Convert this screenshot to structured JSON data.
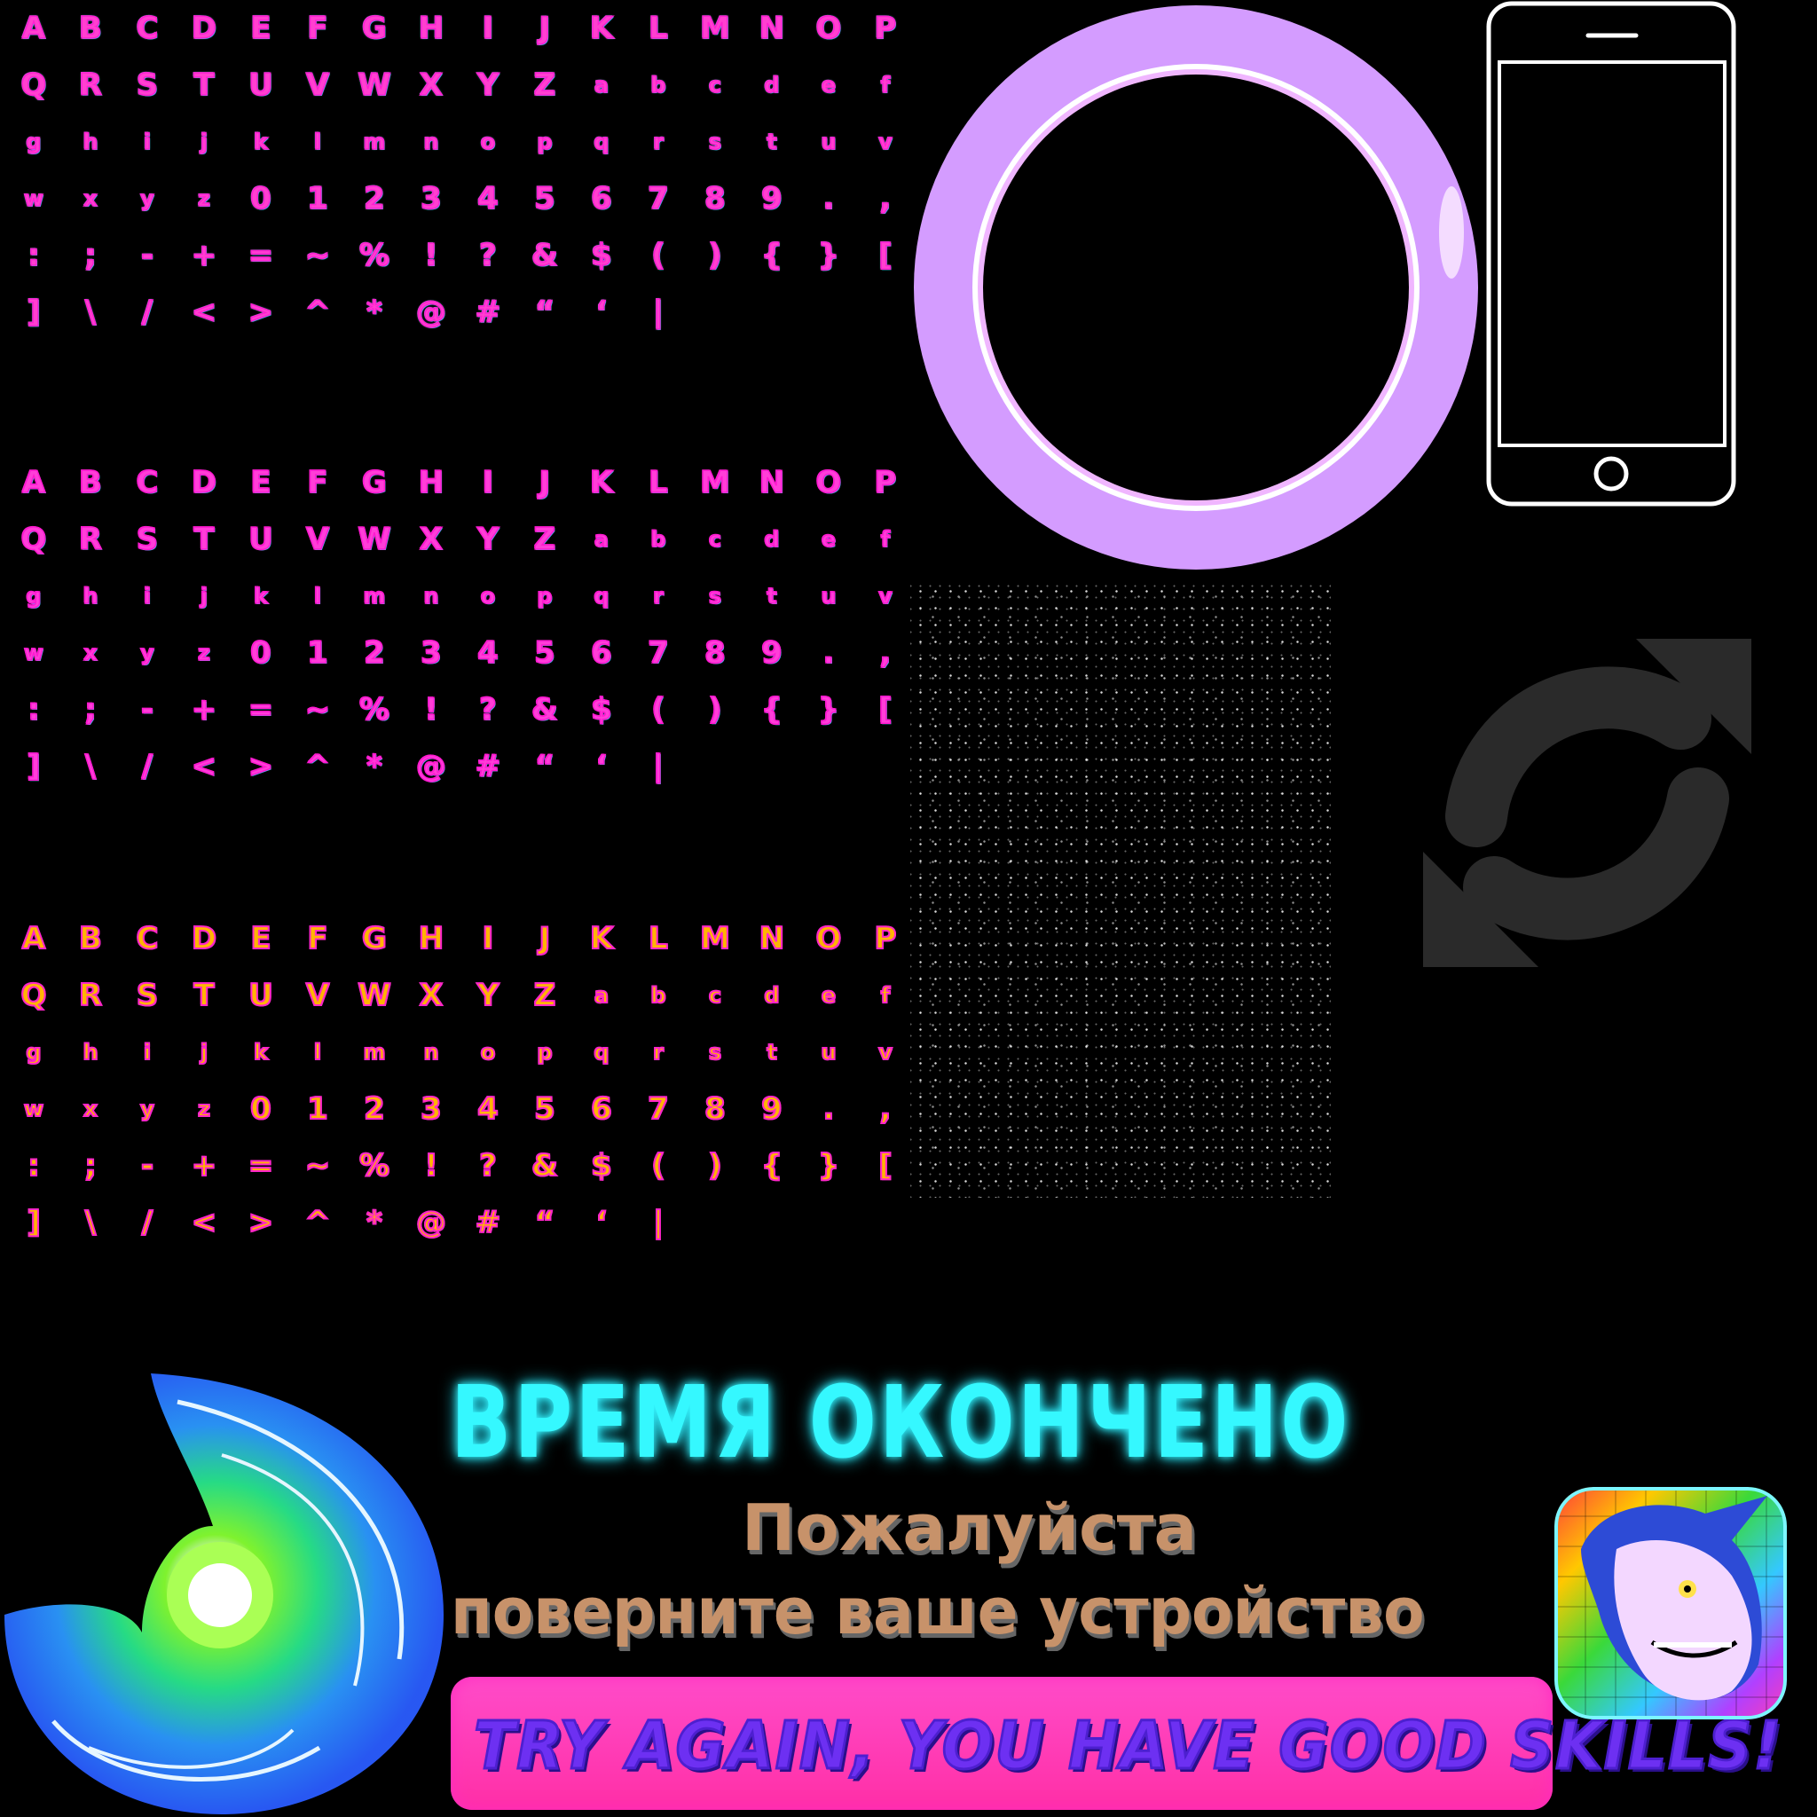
{
  "glyphs": [
    "A",
    "B",
    "C",
    "D",
    "E",
    "F",
    "G",
    "H",
    "I",
    "J",
    "K",
    "L",
    "M",
    "N",
    "O",
    "P",
    "Q",
    "R",
    "S",
    "T",
    "U",
    "V",
    "W",
    "X",
    "Y",
    "Z",
    "a",
    "b",
    "c",
    "d",
    "e",
    "f",
    "g",
    "h",
    "i",
    "j",
    "k",
    "l",
    "m",
    "n",
    "o",
    "p",
    "q",
    "r",
    "s",
    "t",
    "u",
    "v",
    "w",
    "x",
    "y",
    "z",
    "0",
    "1",
    "2",
    "3",
    "4",
    "5",
    "6",
    "7",
    "8",
    "9",
    ".",
    ",",
    ":",
    ";",
    "-",
    "+",
    "=",
    "~",
    "%",
    "!",
    "?",
    "&",
    "$",
    "(",
    ")",
    "{",
    "}",
    "[",
    "]",
    "\\",
    "/",
    "<",
    ">",
    "^",
    "*",
    "@",
    "#",
    "“",
    "‘",
    "|"
  ],
  "title": "ВРЕМЯ ОКОНЧЕНО",
  "rotate_prompt": {
    "line1": "Пожалуйста",
    "line2": "поверните ваше устройство"
  },
  "try_again": "TRY AGAIN, YOU HAVE GOOD SKILLS!",
  "colors": {
    "pink_font": "#ff40d0",
    "orange_font": "#ffb400",
    "bubble": "#d9a6ff",
    "title_cyan": "#35f8ff",
    "rotate_text": "#c7926a",
    "banner_pink": "#ff3fb8",
    "banner_text": "#6d30f2",
    "refresh_icon": "#2b2b2b"
  },
  "icons": [
    "bubble-ring-icon",
    "phone-outline-icon",
    "refresh-arrows-icon",
    "glow-portal-icon",
    "unicorn-app-icon",
    "starfield-texture"
  ]
}
